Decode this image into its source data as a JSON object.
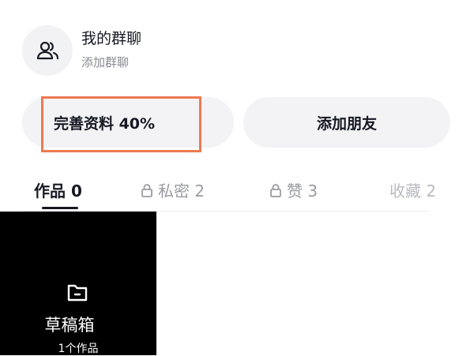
{
  "group": {
    "title": "我的群聊",
    "subtitle": "添加群聊",
    "icon": "users-icon"
  },
  "actions": {
    "profile_label": "完善资料 40%",
    "profile_progress_percent": 40,
    "add_friend_label": "添加朋友",
    "highlight_color": "#ee7a52"
  },
  "tabs": [
    {
      "label": "作品 0",
      "locked": false,
      "active": true
    },
    {
      "label": "私密 2",
      "locked": true,
      "active": false
    },
    {
      "label": "赞 3",
      "locked": true,
      "active": false
    },
    {
      "label": "收藏 2",
      "locked": false,
      "active": false
    }
  ],
  "draft": {
    "title": "草稿箱",
    "count_label": "1个作品",
    "icon": "folder-icon"
  }
}
